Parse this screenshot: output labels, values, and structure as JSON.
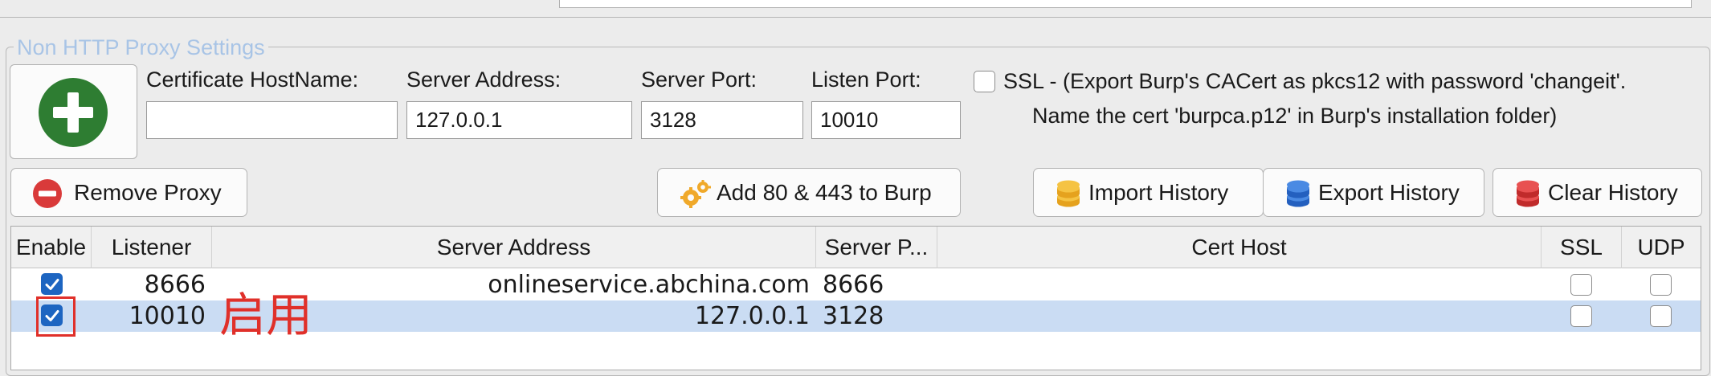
{
  "group_title": "Non HTTP Proxy Settings",
  "form": {
    "cert_hostname_label": "Certificate  HostName:",
    "cert_hostname_value": "",
    "server_address_label": "Server Address:",
    "server_address_value": "127.0.0.1",
    "server_port_label": "Server Port:",
    "server_port_value": "3128",
    "listen_port_label": "Listen Port:",
    "listen_port_value": "10010",
    "ssl_label_line1": "SSL - (Export Burp's CACert as pkcs12 with  password 'changeit'.",
    "ssl_label_line2": "Name the cert 'burpca.p12'  in Burp's installation folder)",
    "ssl_checked": false
  },
  "buttons": {
    "remove_proxy": "Remove Proxy",
    "add_ports": "Add 80 & 443 to Burp",
    "import_history": "Import History",
    "export_history": "Export History",
    "clear_history": "Clear History"
  },
  "table": {
    "columns": [
      "Enable",
      "Listener",
      "Server Address",
      "Server P...",
      "Cert Host",
      "SSL",
      "UDP"
    ],
    "rows": [
      {
        "enable": true,
        "listener": "8666",
        "server_address": "onlineservice.abchina.com",
        "server_port": "8666",
        "cert_host": "",
        "ssl": false,
        "udp": false,
        "selected": false
      },
      {
        "enable": true,
        "listener": "10010",
        "server_address": "127.0.0.1",
        "server_port": "3128",
        "cert_host": "",
        "ssl": false,
        "udp": false,
        "selected": true
      }
    ]
  },
  "annotation": {
    "text": "启用",
    "color": "#e0302a"
  },
  "colors": {
    "add_icon": "#2e7d32",
    "remove_icon": "#d93a3a",
    "import_icon": "#f2b632",
    "export_icon": "#2f6fd0",
    "clear_icon": "#d63b3b",
    "selection": "#cadcf3",
    "checkbox_checked": "#1d65c1"
  },
  "icons": {
    "add": "plus-circle-icon",
    "remove": "minus-circle-icon",
    "add_ports": "gears-icon",
    "import": "database-icon",
    "export": "database-icon",
    "clear": "database-icon"
  }
}
